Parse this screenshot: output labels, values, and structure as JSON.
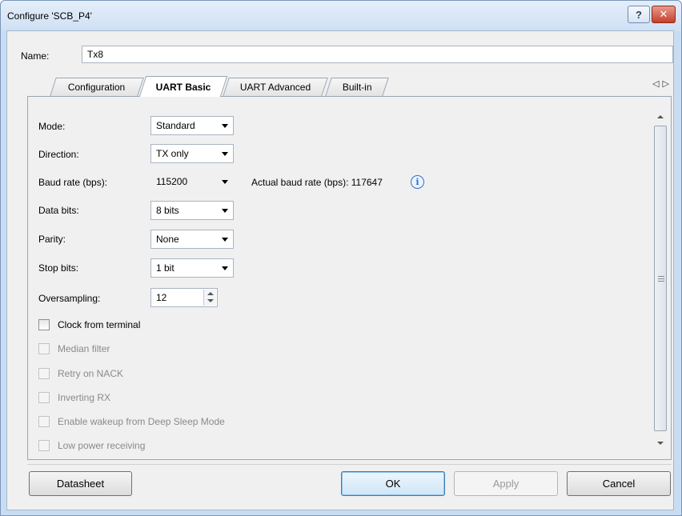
{
  "window": {
    "title": "Configure 'SCB_P4'",
    "help_glyph": "?",
    "close_glyph": "✕"
  },
  "name": {
    "label": "Name:",
    "value": "Tx8"
  },
  "tabs": [
    {
      "label": "Configuration",
      "active": false
    },
    {
      "label": "UART Basic",
      "active": true
    },
    {
      "label": "UART Advanced",
      "active": false
    },
    {
      "label": "Built-in",
      "active": false
    }
  ],
  "tab_scroll": {
    "left": "◁",
    "right": "▷"
  },
  "fields": {
    "mode": {
      "label": "Mode:",
      "value": "Standard"
    },
    "direction": {
      "label": "Direction:",
      "value": "TX only"
    },
    "baud": {
      "label": "Baud rate (bps):",
      "value": "115200"
    },
    "actual_baud": {
      "label": "Actual baud rate (bps): 117647"
    },
    "data_bits": {
      "label": "Data bits:",
      "value": "8 bits"
    },
    "parity": {
      "label": "Parity:",
      "value": "None"
    },
    "stop_bits": {
      "label": "Stop bits:",
      "value": "1 bit"
    },
    "oversampling": {
      "label": "Oversampling:",
      "value": "12"
    }
  },
  "checkboxes": {
    "clock_from_terminal": {
      "label": "Clock from terminal",
      "checked": false,
      "enabled": true
    },
    "median_filter": {
      "label": "Median filter",
      "checked": false,
      "enabled": false
    },
    "retry_on_nack": {
      "label": "Retry on NACK",
      "checked": false,
      "enabled": false
    },
    "inverting_rx": {
      "label": "Inverting RX",
      "checked": false,
      "enabled": false
    },
    "enable_wakeup": {
      "label": "Enable wakeup from Deep Sleep Mode",
      "checked": false,
      "enabled": false
    },
    "low_power_receiving": {
      "label": "Low power receiving",
      "checked": false,
      "enabled": false
    }
  },
  "info_icon_glyph": "i",
  "buttons": {
    "datasheet": "Datasheet",
    "ok": "OK",
    "apply": "Apply",
    "cancel": "Cancel"
  },
  "icons": [
    "help-icon",
    "close-icon",
    "info-icon",
    "chevron-down-icon",
    "spinner-up-icon",
    "spinner-down-icon",
    "scroll-up-icon",
    "scroll-down-icon"
  ]
}
